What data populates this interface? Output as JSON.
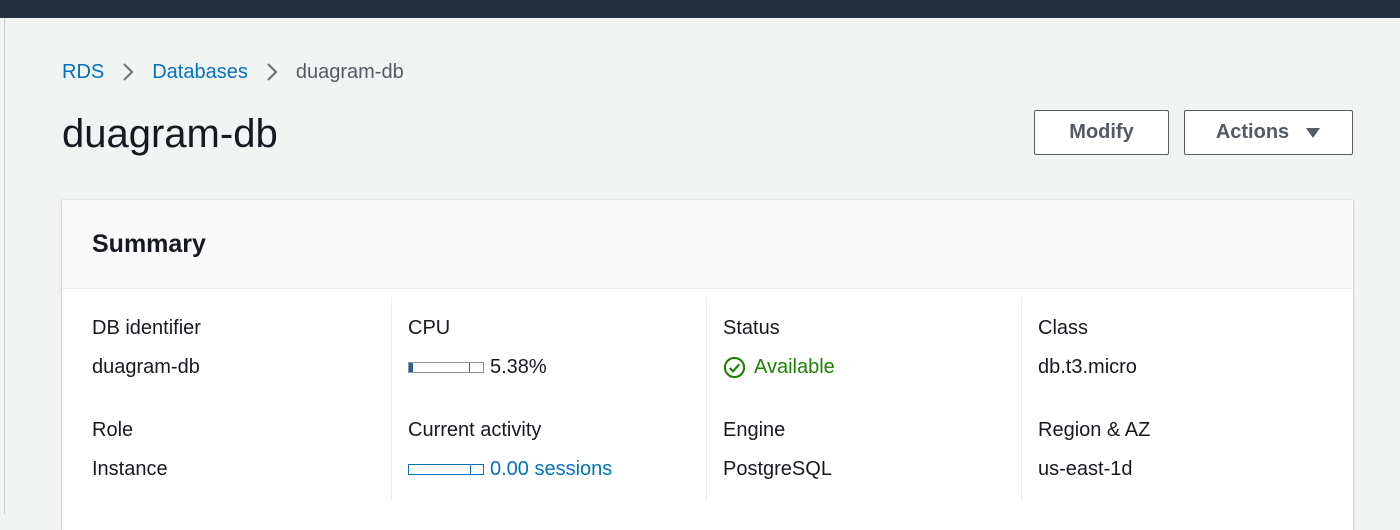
{
  "breadcrumb": {
    "items": [
      "RDS",
      "Databases"
    ],
    "current": "duagram-db"
  },
  "page": {
    "title": "duagram-db"
  },
  "toolbar": {
    "modify_label": "Modify",
    "actions_label": "Actions"
  },
  "summary": {
    "title": "Summary",
    "db_identifier": {
      "label": "DB identifier",
      "value": "duagram-db"
    },
    "role": {
      "label": "Role",
      "value": "Instance"
    },
    "cpu": {
      "label": "CPU",
      "value": "5.38%",
      "percent": 5.38
    },
    "current_activity": {
      "label": "Current activity",
      "value": "0.00 sessions",
      "sessions": 0.0
    },
    "status": {
      "label": "Status",
      "value": "Available"
    },
    "engine": {
      "label": "Engine",
      "value": "PostgreSQL"
    },
    "class": {
      "label": "Class",
      "value": "db.t3.micro"
    },
    "region_az": {
      "label": "Region & AZ",
      "value": "us-east-1d"
    }
  },
  "colors": {
    "topbar": "#232f3e",
    "link": "#0073bb",
    "status_available": "#1d8102",
    "cpu_threshold_tick": "#d13212",
    "bar_fill": "#2a5f9e"
  },
  "icons": {
    "breadcrumb_separator": "chevron-right-icon",
    "actions_caret": "caret-down-icon",
    "status": "check-circle-icon"
  }
}
